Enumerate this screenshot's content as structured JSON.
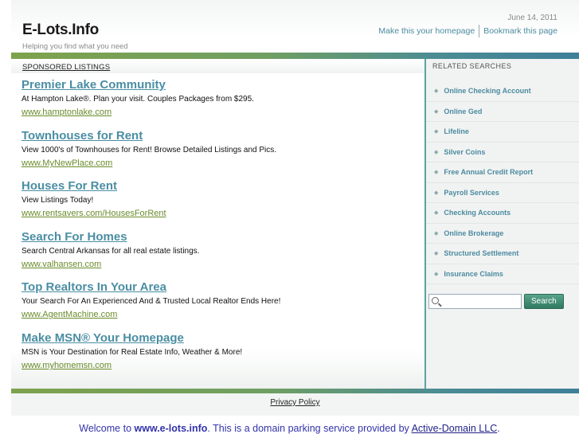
{
  "header": {
    "site_title": "E-Lots.Info",
    "tagline": "Helping you find what you need",
    "date": "June 14, 2011",
    "homepage_link": "Make this your homepage",
    "bookmark_link": "Bookmark this page"
  },
  "main": {
    "sponsored_label": "SPONSORED LISTINGS",
    "listings": [
      {
        "title": "Premier Lake Community",
        "desc": "At Hampton Lake®. Plan your visit. Couples Packages from $295.",
        "url": "www.hamptonlake.com"
      },
      {
        "title": "Townhouses for Rent",
        "desc": "View 1000's of Townhouses for Rent! Browse Detailed Listings and Pics.",
        "url": "www.MyNewPlace.com"
      },
      {
        "title": "Houses For Rent",
        "desc": "View Listings Today!",
        "url": "www.rentsavers.com/HousesForRent"
      },
      {
        "title": "Search For Homes",
        "desc": "Search Central Arkansas for all real estate listings.",
        "url": "www.valhansen.com"
      },
      {
        "title": "Top Realtors In Your Area",
        "desc": "Your Search For An Experienced And & Trusted Local Realtor Ends Here!",
        "url": "www.AgentMachine.com"
      },
      {
        "title": "Make MSN® Your Homepage",
        "desc": "MSN is Your Destination for Real Estate Info, Weather & More!",
        "url": "www.myhomemsn.com"
      }
    ]
  },
  "side": {
    "title": "RELATED SEARCHES",
    "items": [
      "Online Checking Account",
      "Online Ged",
      "Lifeline",
      "Silver Coins",
      "Free Annual Credit Report",
      "Payroll Services",
      "Checking Accounts",
      "Online Brokerage",
      "Structured Settlement",
      "Insurance Claims"
    ],
    "search_button": "Search",
    "search_value": ""
  },
  "footer": {
    "privacy": "Privacy Policy",
    "welcome_prefix": "Welcome to ",
    "welcome_domain": "www.e-lots.info",
    "welcome_mid": ". This is a domain parking service provided by ",
    "welcome_provider": "Active-Domain LLC",
    "welcome_suffix": "."
  }
}
